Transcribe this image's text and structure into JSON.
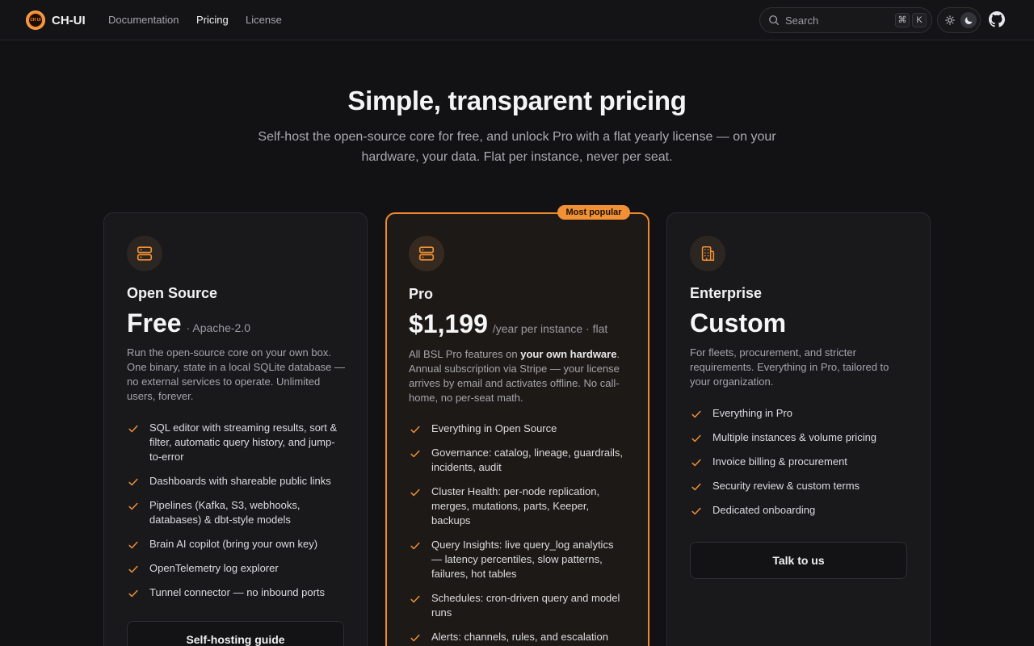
{
  "nav": {
    "brand": "CH-UI",
    "logo_text": "CH UI",
    "links": [
      "Documentation",
      "Pricing",
      "License"
    ],
    "active": "Pricing",
    "search_label": "Search",
    "shortcut": [
      "⌘",
      "K"
    ]
  },
  "hero": {
    "title": "Simple, transparent pricing",
    "subtitle": "Self-host the open-source core for free, and unlock Pro with a flat yearly license — on your hardware, your data. Flat per instance, never per seat."
  },
  "plans": [
    {
      "name": "Open Source",
      "price": "Free",
      "price_suffix": "· Apache-2.0",
      "description": "Run the open-source core on your own box. One binary, state in a local SQLite database — no external services to operate. Unlimited users, forever.",
      "features": [
        "SQL editor with streaming results, sort & filter, automatic query history, and jump-to-error",
        "Dashboards with shareable public links",
        "Pipelines (Kafka, S3, webhooks, databases) & dbt-style models",
        "Brain AI copilot (bring your own key)",
        "OpenTelemetry log explorer",
        "Tunnel connector — no inbound ports"
      ],
      "cta": "Self-hosting guide",
      "icon": "server-icon"
    },
    {
      "name": "Pro",
      "badge": "Most popular",
      "price": "$1,199",
      "price_suffix": "/year per instance · flat",
      "description_pre": "All BSL Pro features on ",
      "description_bold": "your own hardware",
      "description_post": ". Annual subscription via Stripe — your license arrives by email and activates offline. No call-home, no per-seat math.",
      "features": [
        "Everything in Open Source",
        "Governance: catalog, lineage, guardrails, incidents, audit",
        "Cluster Health: per-node replication, merges, mutations, parts, Keeper, backups",
        "Query Insights: live query_log analytics — latency percentiles, slow patterns, failures, hot tables",
        "Schedules: cron-driven query and model runs",
        "Alerts: channels, rules, and escalation"
      ],
      "icon": "server-icon"
    },
    {
      "name": "Enterprise",
      "price": "Custom",
      "description": "For fleets, procurement, and stricter requirements. Everything in Pro, tailored to your organization.",
      "features": [
        "Everything in Pro",
        "Multiple instances & volume pricing",
        "Invoice billing & procurement",
        "Security review & custom terms",
        "Dedicated onboarding"
      ],
      "cta": "Talk to us",
      "icon": "building-icon"
    }
  ],
  "colors": {
    "accent": "#f19034",
    "background": "#121214",
    "card": "#19191c"
  }
}
